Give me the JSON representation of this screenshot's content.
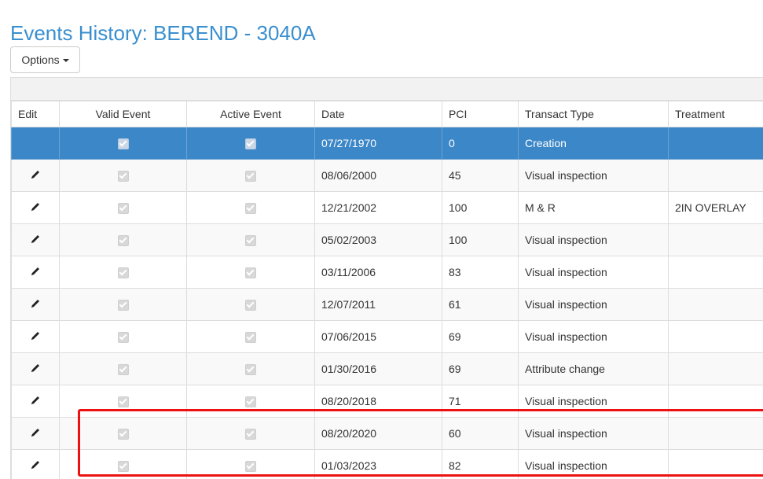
{
  "page": {
    "title": "Events History: BEREND - 3040A"
  },
  "toolbar": {
    "options_label": "Options"
  },
  "table": {
    "headers": {
      "edit": "Edit",
      "valid": "Valid Event",
      "active": "Active Event",
      "date": "Date",
      "pci": "PCI",
      "type": "Transact Type",
      "treatment": "Treatment"
    },
    "rows": [
      {
        "date": "07/27/1970",
        "pci": "0",
        "type": "Creation",
        "treatment": "",
        "valid": true,
        "active": true,
        "selected": true
      },
      {
        "date": "08/06/2000",
        "pci": "45",
        "type": "Visual inspection",
        "treatment": "",
        "valid": true,
        "active": true
      },
      {
        "date": "12/21/2002",
        "pci": "100",
        "type": "M & R",
        "treatment": "2IN OVERLAY",
        "valid": true,
        "active": true
      },
      {
        "date": "05/02/2003",
        "pci": "100",
        "type": "Visual inspection",
        "treatment": "",
        "valid": true,
        "active": true
      },
      {
        "date": "03/11/2006",
        "pci": "83",
        "type": "Visual inspection",
        "treatment": "",
        "valid": true,
        "active": true
      },
      {
        "date": "12/07/2011",
        "pci": "61",
        "type": "Visual inspection",
        "treatment": "",
        "valid": true,
        "active": true
      },
      {
        "date": "07/06/2015",
        "pci": "69",
        "type": "Visual inspection",
        "treatment": "",
        "valid": true,
        "active": true
      },
      {
        "date": "01/30/2016",
        "pci": "69",
        "type": "Attribute change",
        "treatment": "",
        "valid": true,
        "active": true
      },
      {
        "date": "08/20/2018",
        "pci": "71",
        "type": "Visual inspection",
        "treatment": "",
        "valid": true,
        "active": true
      },
      {
        "date": "08/20/2020",
        "pci": "60",
        "type": "Visual inspection",
        "treatment": "",
        "valid": true,
        "active": true
      },
      {
        "date": "01/03/2023",
        "pci": "82",
        "type": "Visual inspection",
        "treatment": "",
        "valid": true,
        "active": true
      }
    ]
  },
  "colors": {
    "title": "#3a8fcf",
    "selected_row": "#3c87c7",
    "highlight_box": "#ee1111"
  },
  "icons": {
    "edit": "pencil-icon",
    "options_caret": "caret-down-icon",
    "checkbox": "checkbox-checked-icon"
  }
}
